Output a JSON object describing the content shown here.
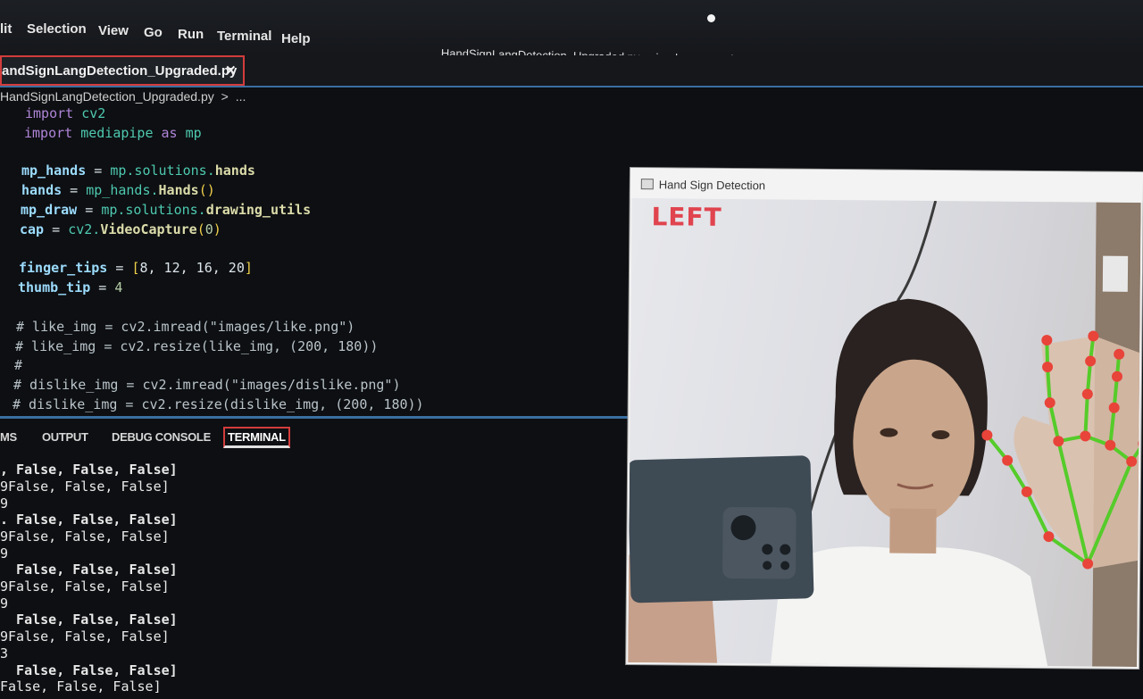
{
  "menubar": {
    "items": [
      "lit",
      "Selection",
      "View",
      "Go",
      "Run",
      "Terminal",
      "Help"
    ],
    "window_title": "HandSignLangDetection_Upgraded.py - sign-language-detection-main - Visual Studio Code"
  },
  "tab": {
    "label": "andSignLangDetection_Upgraded.py",
    "close": "✕"
  },
  "breadcrumb": {
    "file": "HandSignLangDetection_Upgraded.py",
    "sep": ">",
    "more": "..."
  },
  "code": {
    "l1": {
      "kw": "import",
      "mod": "cv2"
    },
    "l2": {
      "kw": "import",
      "mod": "mediapipe",
      "as": "as",
      "alias": "mp"
    },
    "l3": {
      "var": "mp_hands",
      "eq": " = ",
      "expr": "mp.solutions.",
      "fn": "hands"
    },
    "l4": {
      "var": "hands",
      "eq": " = ",
      "expr": "mp_hands.",
      "fn": "Hands",
      "paren": "()"
    },
    "l5": {
      "var": "mp_draw",
      "eq": " = ",
      "expr": "mp.solutions.",
      "fn": "drawing_utils"
    },
    "l6": {
      "var": "cap",
      "eq": " = ",
      "expr": "cv2.",
      "fn": "VideoCapture",
      "open": "(",
      "num": "0",
      "close": ")"
    },
    "l7": {
      "var": "finger_tips",
      "eq": " = ",
      "open": "[",
      "vals": "8, 12, 16, 20",
      "close": "]"
    },
    "l8": {
      "var": "thumb_tip",
      "eq": " = ",
      "num": "4"
    },
    "l9": "# like_img = cv2.imread(\"images/like.png\")",
    "l10": "# like_img = cv2.resize(like_img, (200, 180))",
    "l11": "#",
    "l12": "# dislike_img = cv2.imread(\"images/dislike.png\")",
    "l13": "# dislike_img = cv2.resize(dislike_img, (200, 180))"
  },
  "panel": {
    "tabs": [
      "MS",
      "OUTPUT",
      "DEBUG CONSOLE",
      "TERMINAL"
    ],
    "active": "TERMINAL"
  },
  "terminal": {
    "lines": [
      ", False, False, False]",
      "9False, False, False]",
      "9",
      ". False, False, False]",
      "9False, False, False]",
      "9",
      "  False, False, False]",
      "9False, False, False]",
      "9",
      "  False, False, False]",
      "9False, False, False]",
      "3",
      "  False, False, False]",
      "False, False, False]"
    ]
  },
  "cv_window": {
    "title": "Hand Sign Detection",
    "label": "LEFT",
    "colors": {
      "label": "#e0444e",
      "landmark": "#e8443a",
      "connection": "#55cc2a"
    }
  }
}
